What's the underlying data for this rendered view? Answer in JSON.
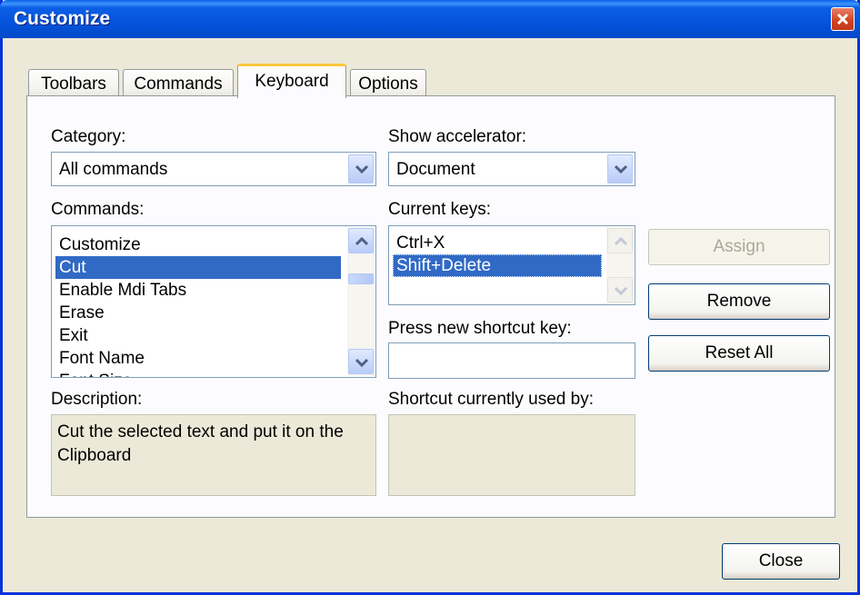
{
  "window": {
    "title": "Customize"
  },
  "tabs": [
    {
      "label": "Toolbars"
    },
    {
      "label": "Commands"
    },
    {
      "label": "Keyboard"
    },
    {
      "label": "Options"
    }
  ],
  "active_tab": "Keyboard",
  "category": {
    "label": "Category:",
    "value": "All commands"
  },
  "show_accelerator": {
    "label": "Show accelerator:",
    "value": "Document"
  },
  "commands": {
    "label": "Commands:",
    "items": [
      "Customize",
      "Cut",
      "Enable Mdi Tabs",
      "Erase",
      "Exit",
      "Font Name",
      "Font Size"
    ],
    "selected": "Cut"
  },
  "current_keys": {
    "label": "Current keys:",
    "items": [
      "Ctrl+X",
      "Shift+Delete"
    ],
    "selected": "Shift+Delete"
  },
  "new_shortcut": {
    "label": "Press new shortcut key:",
    "value": ""
  },
  "description": {
    "label": "Description:",
    "text": "Cut the selected text and put it on the Clipboard"
  },
  "used_by": {
    "label": "Shortcut currently used by:",
    "text": ""
  },
  "buttons": {
    "assign": "Assign",
    "remove": "Remove",
    "reset_all": "Reset All",
    "close": "Close"
  },
  "colors": {
    "title_bar": "#0553dc",
    "selection": "#316ac5",
    "active_tab_accent": "#ffc83c"
  },
  "icons": {
    "close": "close-icon",
    "dropdown": "chevron-down-icon",
    "scroll_up": "arrow-up-icon",
    "scroll_down": "arrow-down-icon"
  }
}
